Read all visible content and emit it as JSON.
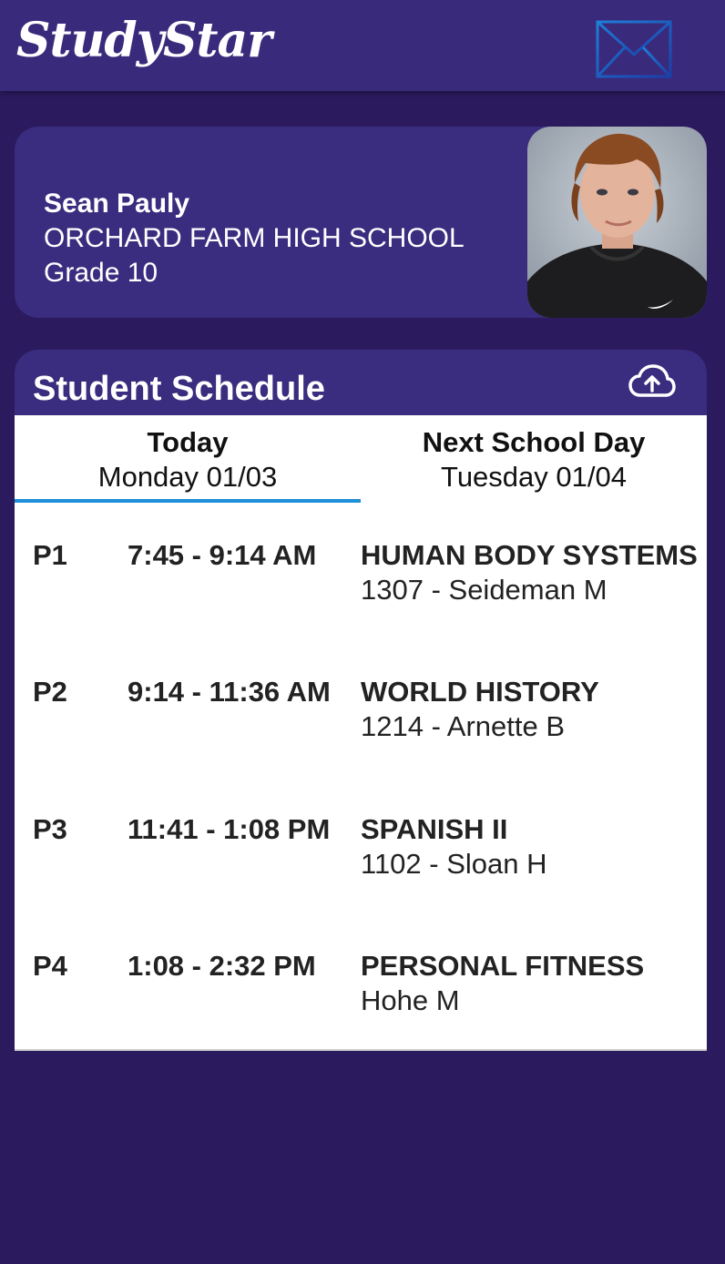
{
  "app": {
    "title": "StudyStar"
  },
  "header": {
    "mail_icon": "mail-icon"
  },
  "profile": {
    "name": "Sean Pauly",
    "school": "ORCHARD FARM HIGH SCHOOL",
    "grade": "Grade 10"
  },
  "schedule": {
    "title": "Student Schedule",
    "upload_icon": "cloud-upload-icon",
    "tabs": [
      {
        "label": "Today",
        "date": "Monday 01/03",
        "active": true
      },
      {
        "label": "Next School Day",
        "date": "Tuesday 01/04",
        "active": false
      }
    ],
    "periods": [
      {
        "period": "P1",
        "time": "7:45 - 9:14 AM",
        "course": "HUMAN BODY SYSTEMS",
        "room": "1307 - Seideman M"
      },
      {
        "period": "P2",
        "time": "9:14 - 11:36 AM",
        "course": "WORLD HISTORY",
        "room": "1214 - Arnette B"
      },
      {
        "period": "P3",
        "time": "11:41 - 1:08 PM",
        "course": "SPANISH II",
        "room": "1102 - Sloan H"
      },
      {
        "period": "P4",
        "time": "1:08 - 2:32 PM",
        "course": "PERSONAL FITNESS",
        "room": "Hohe M"
      }
    ]
  },
  "colors": {
    "background": "#2b1a5e",
    "header": "#3a2a7c",
    "card": "#3a2c7e",
    "active_tab_indicator": "#1e8fd8"
  }
}
